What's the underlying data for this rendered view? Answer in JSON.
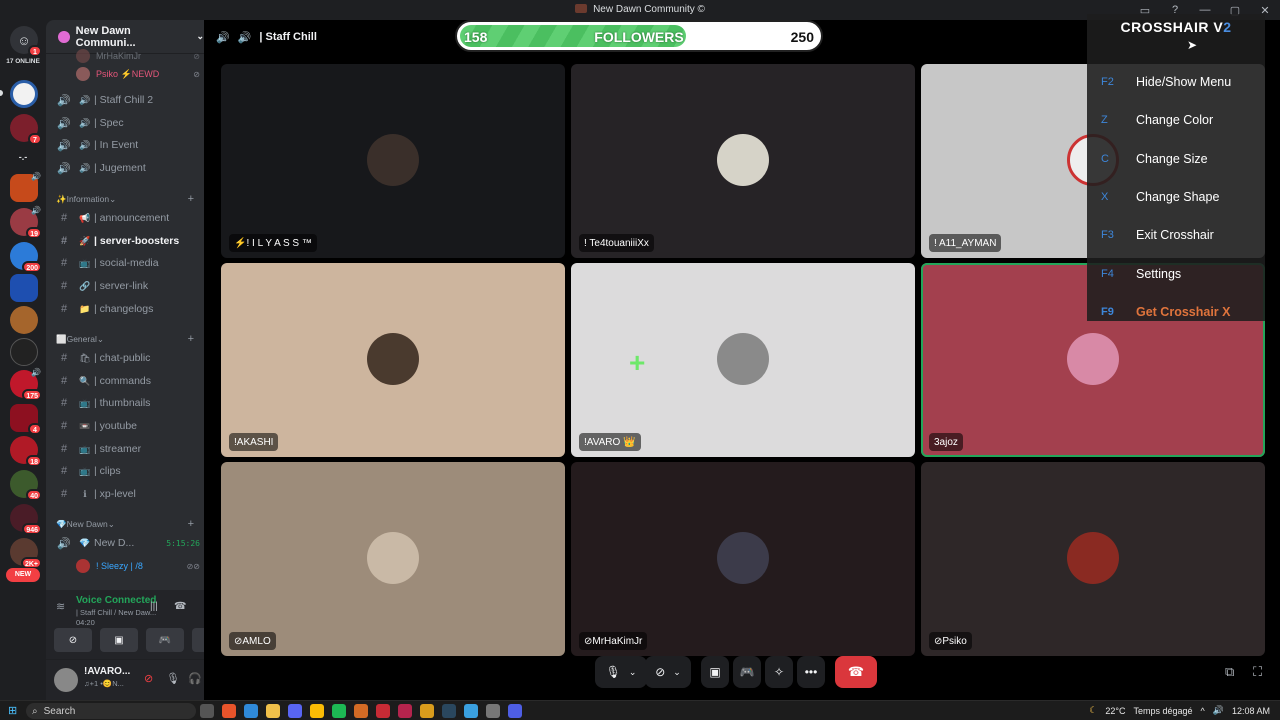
{
  "window": {
    "title": "New Dawn Community ©"
  },
  "rail": {
    "online_label": "17 ONLINE",
    "home_badge": "1",
    "badges": [
      "7",
      "19",
      "200",
      "175",
      "4",
      "18",
      "40",
      "946",
      "2K+"
    ],
    "new_label": "NEW"
  },
  "guild": {
    "name": "New Dawn Communi..."
  },
  "sidebar": {
    "top_users": [
      {
        "name": "MrHaKimJr"
      },
      {
        "name": "Psiko ⚡NEWD"
      }
    ],
    "voice_channels": [
      {
        "label": "| Staff Chill 2"
      },
      {
        "label": "| Spec"
      },
      {
        "label": "| In Event"
      },
      {
        "label": "| Jugement"
      }
    ],
    "info_category": "Information",
    "info_channels": [
      {
        "emoji": "📢",
        "label": "| announcement"
      },
      {
        "emoji": "🚀",
        "label": "| server-boosters"
      },
      {
        "emoji": "📺",
        "label": "| social-media"
      },
      {
        "emoji": "🔗",
        "label": "| server-link"
      },
      {
        "emoji": "📁",
        "label": "| changelogs"
      }
    ],
    "general_category": "General",
    "general_channels": [
      {
        "emoji": "🛍",
        "label": "| chat-public"
      },
      {
        "emoji": "🔍",
        "label": "| commands"
      },
      {
        "emoji": "📺",
        "label": "| thumbnails"
      },
      {
        "emoji": "📼",
        "label": "| youtube"
      },
      {
        "emoji": "📺",
        "label": "| streamer"
      },
      {
        "emoji": "📺",
        "label": "| clips"
      },
      {
        "emoji": "ℹ",
        "label": "| xp-level"
      }
    ],
    "newdawn_category": "New Dawn",
    "newdawn_channel": {
      "label": "New D...",
      "timer": "5:15:26"
    },
    "newdawn_user": "! Sleezy | /8"
  },
  "voice_panel": {
    "status": "Voice Connected",
    "channel": "| Staff Chill / New Daw...",
    "time": "04:20"
  },
  "user_panel": {
    "name": "!AVARO...",
    "status": "♫+1 •😊N..."
  },
  "header": {
    "channel": "| Staff Chill"
  },
  "followers": {
    "current": "158",
    "label": "FOLLOWERS",
    "goal": "250",
    "progress": 0.632
  },
  "tiles": [
    {
      "name": "⚡! I L Y A S S ™",
      "bg": "#17181b"
    },
    {
      "name": "! Te4touaniiiXx",
      "bg": "#262326"
    },
    {
      "name": "! A11_AYMAN",
      "bg": "#c7c7c7"
    },
    {
      "name": "!AKASHI",
      "bg": "#cdb59e"
    },
    {
      "name": "!AVARO 👑",
      "bg": "#dcdbdc"
    },
    {
      "name": "3ajoz",
      "bg": "#a3404e"
    },
    {
      "name": "AMLO",
      "bg": "#9d8c7a"
    },
    {
      "name": "MrHaKimJr",
      "bg": "#241b1d"
    },
    {
      "name": "Psiko",
      "bg": "#2e2728"
    }
  ],
  "crosshair": {
    "title_main": "CROSSHAIR V",
    "title_num": "2",
    "items": [
      {
        "key": "F2",
        "label": "Hide/Show Menu"
      },
      {
        "key": "Z",
        "label": "Change Color"
      },
      {
        "key": "C",
        "label": "Change Size"
      },
      {
        "key": "X",
        "label": "Change Shape"
      },
      {
        "key": "F3",
        "label": "Exit Crosshair"
      },
      {
        "key": "F4",
        "label": "Settings"
      },
      {
        "key": "F9",
        "label": "Get Crosshair X"
      }
    ]
  },
  "taskbar": {
    "search": "Search",
    "weather": "22°C",
    "weather_desc": "Temps dégagé",
    "clock": "12:08 AM"
  }
}
